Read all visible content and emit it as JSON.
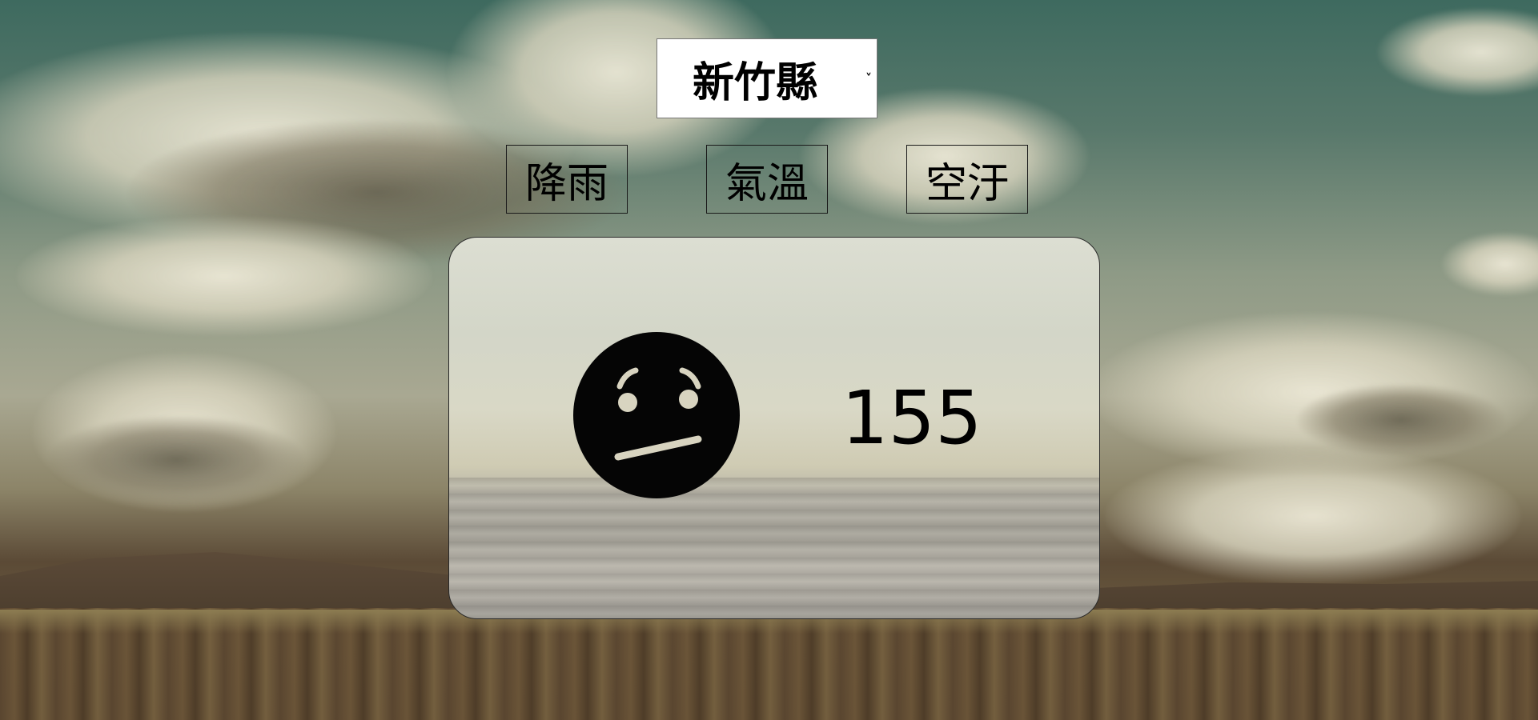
{
  "county_select": {
    "selected": "新竹縣",
    "chevron": "˅"
  },
  "tabs": [
    {
      "label": "降雨"
    },
    {
      "label": "氣溫"
    },
    {
      "label": "空汙"
    }
  ],
  "card": {
    "icon": "confused-face-icon",
    "value": "155"
  }
}
